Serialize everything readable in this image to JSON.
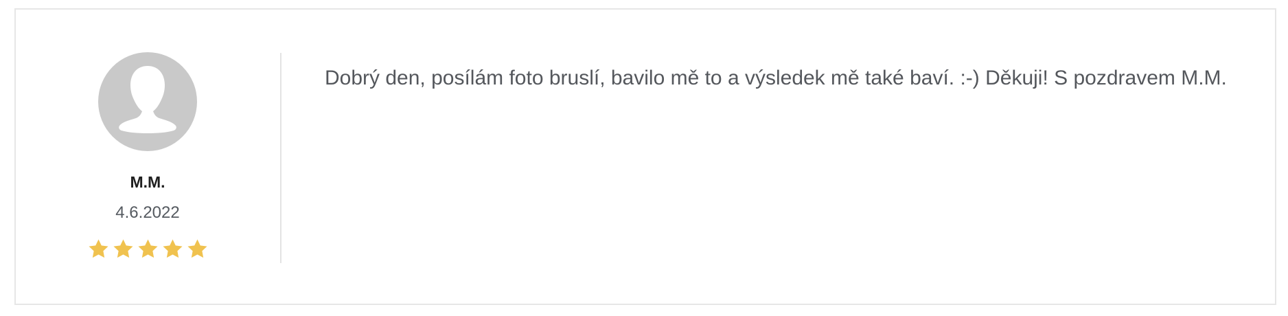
{
  "review": {
    "author": "M.M.",
    "date": "4.6.2022",
    "rating": 5,
    "rating_max": 5,
    "text": "Dobrý den, posílám foto bruslí, bavilo mě to a výsledek mě také baví. :-) Děkuji! S pozdravem M.M.",
    "avatar_icon": "default-user-avatar-icon",
    "star_icon": "star-icon"
  },
  "colors": {
    "star": "#f0c24f",
    "avatar_bg": "#c9c9c9",
    "avatar_figure": "#ffffff",
    "text": "#54575c",
    "border": "#e6e6e6"
  }
}
